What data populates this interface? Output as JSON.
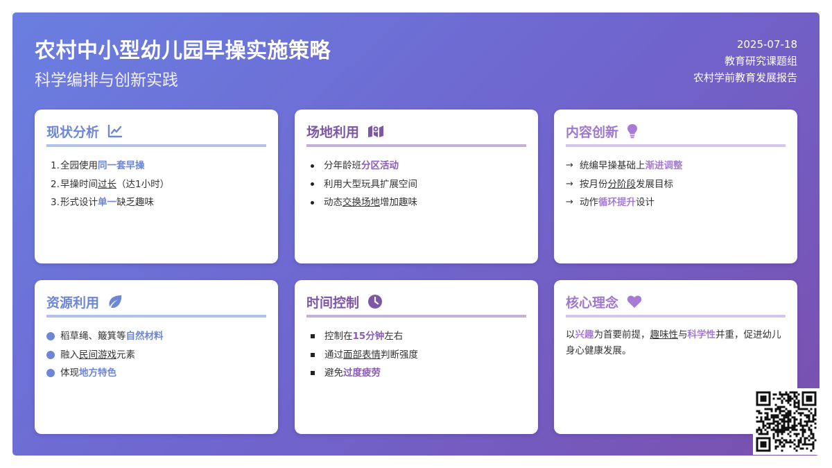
{
  "header": {
    "title": "农村中小型幼儿园早操实施策略",
    "subtitle": "科学编排与创新实践",
    "date": "2025-07-18",
    "author": "教育研究课题组",
    "report": "农村学前教育发展报告"
  },
  "cards": {
    "status": {
      "title": "现状分析",
      "icon": "chart-line-icon",
      "items": [
        {
          "n": "1.",
          "a": "全园使用",
          "b": "同一套早操",
          "c": ""
        },
        {
          "n": "2.",
          "a": "早操时间",
          "b": "过长",
          "c": "（达1小时）"
        },
        {
          "n": "3.",
          "a": "形式设计",
          "b": "单一",
          "c": "缺乏趣味"
        }
      ]
    },
    "space": {
      "title": "场地利用",
      "icon": "map-icon",
      "items": [
        {
          "a": "分年龄班",
          "b": "分区活动",
          "c": ""
        },
        {
          "a": "利用大型玩具扩展空间",
          "b": "",
          "c": ""
        },
        {
          "a": "动态",
          "b": "交换场地",
          "c": "增加趣味"
        }
      ]
    },
    "content": {
      "title": "内容创新",
      "icon": "lightbulb-icon",
      "items": [
        {
          "a": "统编早操基础上",
          "b": "渐进调整",
          "c": ""
        },
        {
          "a": "按月份",
          "b": "分阶段",
          "c": "发展目标"
        },
        {
          "a": "动作",
          "b": "循环提升",
          "c": "设计"
        }
      ]
    },
    "resource": {
      "title": "资源利用",
      "icon": "leaf-icon",
      "items": [
        {
          "a": "稻草绳、簸箕等",
          "b": "自然材料",
          "c": ""
        },
        {
          "a": "融入",
          "b": "民间游戏",
          "c": "元素"
        },
        {
          "a": "体现",
          "b": "地方特色",
          "c": ""
        }
      ]
    },
    "time": {
      "title": "时间控制",
      "icon": "clock-icon",
      "items": [
        {
          "a": "控制在",
          "b": "15分钟",
          "c": "左右"
        },
        {
          "a": "通过",
          "b": "面部表情",
          "c": "判断强度"
        },
        {
          "a": "避免",
          "b": "过度疲劳",
          "c": ""
        }
      ]
    },
    "core": {
      "title": "核心理念",
      "icon": "heart-icon",
      "p1": "以",
      "p2": "兴趣",
      "p3": "为首要前提，",
      "p4": "趣味性",
      "p5": "与",
      "p6": "科学性",
      "p7": "并重，促进幼儿身心健康发展。"
    }
  },
  "colors": {
    "gradient_start": "#6a7fe0",
    "gradient_end": "#7a4fae",
    "blue_accent": "#6d86d6",
    "purple_accent": "#8a5bb8",
    "lavender_accent": "#a67bd6"
  },
  "qr_code": "qr-code-image"
}
